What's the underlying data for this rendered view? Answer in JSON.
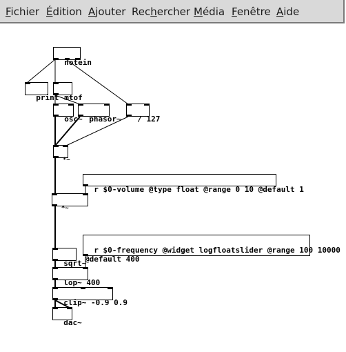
{
  "menubar": {
    "items": [
      {
        "pre": "",
        "key": "F",
        "post": "ichier"
      },
      {
        "pre": "",
        "key": "É",
        "post": "dition"
      },
      {
        "pre": "",
        "key": "A",
        "post": "jouter"
      },
      {
        "pre": "Rec",
        "key": "h",
        "post": "ercher"
      },
      {
        "pre": "",
        "key": "M",
        "post": "édia"
      },
      {
        "pre": "",
        "key": "F",
        "post": "enêtre"
      },
      {
        "pre": "",
        "key": "A",
        "post": "ide"
      }
    ]
  },
  "patch": {
    "objects": {
      "notein": "notein",
      "print": "print",
      "mtof": "mtof",
      "osc": "osc~",
      "phasor": "phasor~",
      "div127": "/ 127",
      "mul1": "*~",
      "recv_volume": "r $0-volume @type float @range 0 10 @default 1",
      "mul2": "*~",
      "recv_frequency": "r $0-frequency @widget logfloatslider @range 100 10000\n@default 400",
      "sqrt": "sqrt~",
      "lop": "lop~ 400",
      "clip": "clip~ -0.9 0.9",
      "dac": "dac~"
    }
  }
}
